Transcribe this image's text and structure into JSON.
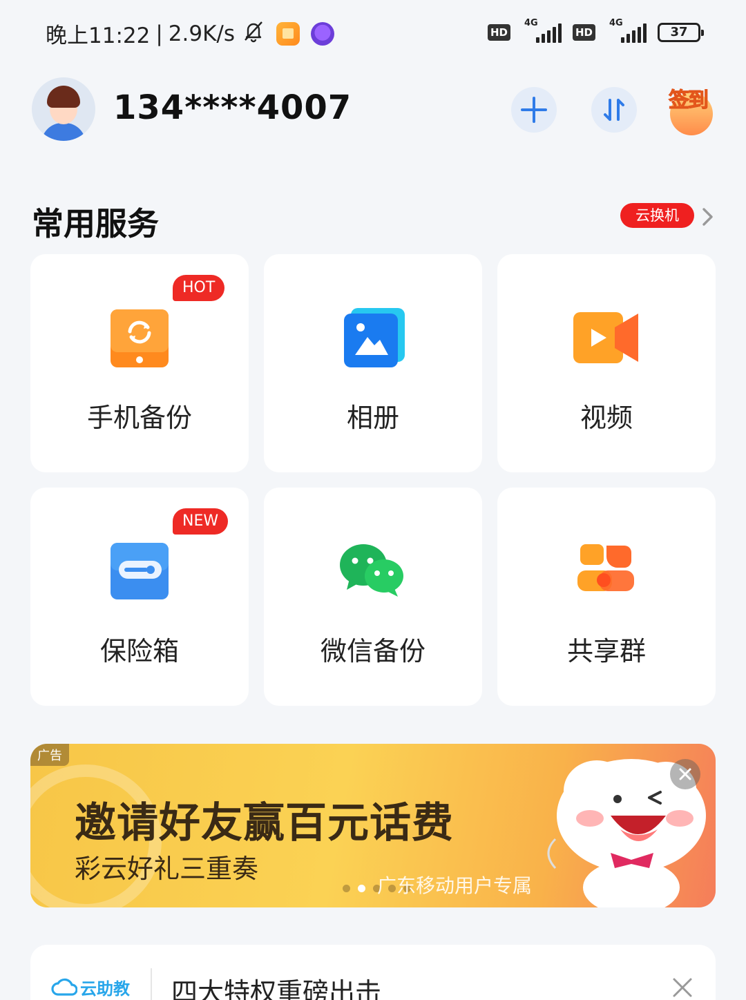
{
  "status_bar": {
    "time": "晚上11:22",
    "separator": "|",
    "speed": "2.9K/s",
    "hd1": "HD",
    "net1": "4G",
    "hd2": "HD",
    "net2": "4G",
    "battery": "37"
  },
  "header": {
    "phone": "134****4007",
    "checkin_label": "签到"
  },
  "services": {
    "title": "常用服务",
    "swap_badge": "云换机",
    "items": [
      {
        "label": "手机备份",
        "badge": "HOT"
      },
      {
        "label": "相册"
      },
      {
        "label": "视频"
      },
      {
        "label": "保险箱",
        "badge": "NEW"
      },
      {
        "label": "微信备份"
      },
      {
        "label": "共享群"
      }
    ]
  },
  "ad": {
    "tag": "广告",
    "headline": "邀请好友赢百元话费",
    "subline": "彩云好礼三重奏",
    "exclusive": "广东移动用户专属",
    "slide_count": 5,
    "active_slide": 2
  },
  "tip": {
    "logo_text": "云助教",
    "text": "四大特权重磅出击"
  },
  "colors": {
    "accent_blue": "#2f7be8",
    "badge_red": "#ee2a25",
    "background": "#f4f6f9"
  }
}
